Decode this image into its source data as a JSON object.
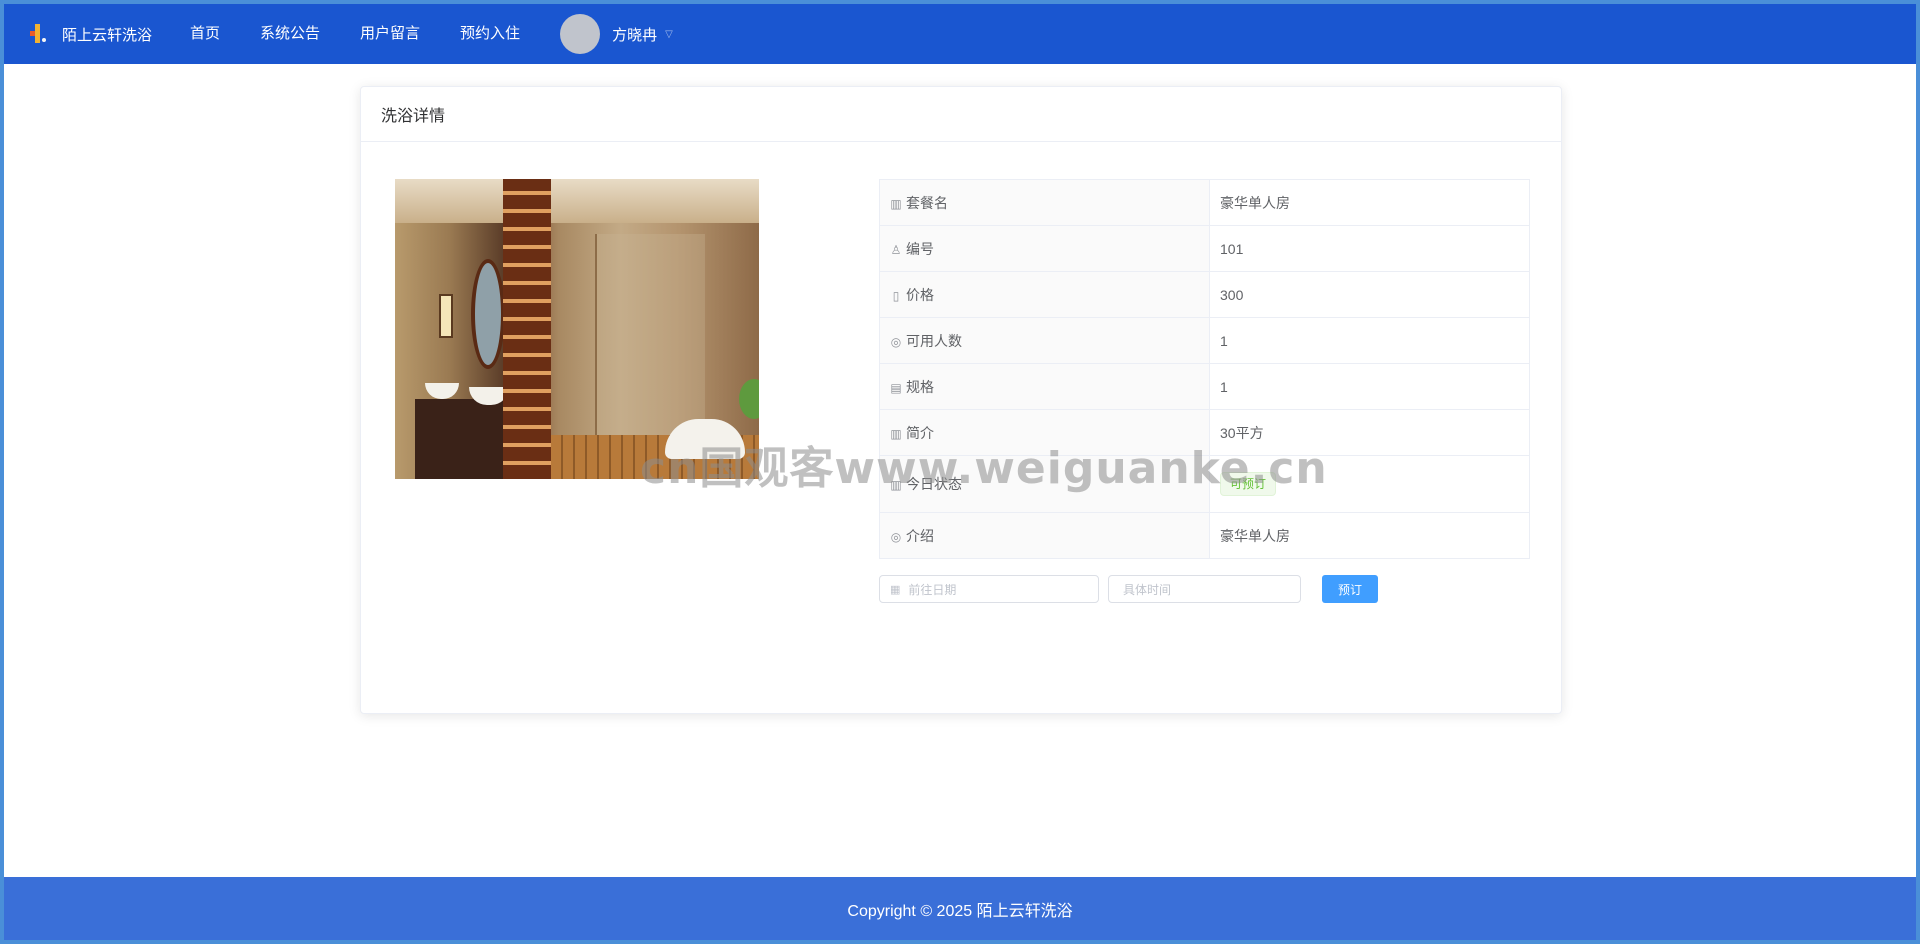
{
  "header": {
    "brand": "陌上云轩洗浴",
    "nav": [
      {
        "label": "首页"
      },
      {
        "label": "系统公告"
      },
      {
        "label": "用户留言"
      },
      {
        "label": "预约入住"
      }
    ],
    "user": {
      "name": "方晓冉"
    }
  },
  "card": {
    "title": "洗浴详情",
    "details": [
      {
        "icon": "office-building-icon",
        "label": "套餐名",
        "value": "豪华单人房"
      },
      {
        "icon": "user-icon",
        "label": "编号",
        "value": "101"
      },
      {
        "icon": "mobile-phone-icon",
        "label": "价格",
        "value": "300"
      },
      {
        "icon": "location-icon",
        "label": "可用人数",
        "value": "1"
      },
      {
        "icon": "tickets-icon",
        "label": "规格",
        "value": "1"
      },
      {
        "icon": "office-building-icon",
        "label": "简介",
        "value": "30平方"
      },
      {
        "icon": "office-building-icon",
        "label": "今日状态",
        "status": "可预订"
      },
      {
        "icon": "location-icon",
        "label": "介绍",
        "value": "豪华单人房"
      }
    ],
    "form": {
      "date_placeholder": "前往日期",
      "time_placeholder": "具体时间",
      "submit_label": "预订"
    }
  },
  "footer": {
    "copyright": "Copyright © 2025 陌上云轩洗浴"
  },
  "watermark": "cn国观客www.weiguanke.cn",
  "colors": {
    "topbar": "#1a56d0",
    "footer": "#3a6fd8",
    "primary": "#409eff",
    "success": "#67c23a"
  }
}
